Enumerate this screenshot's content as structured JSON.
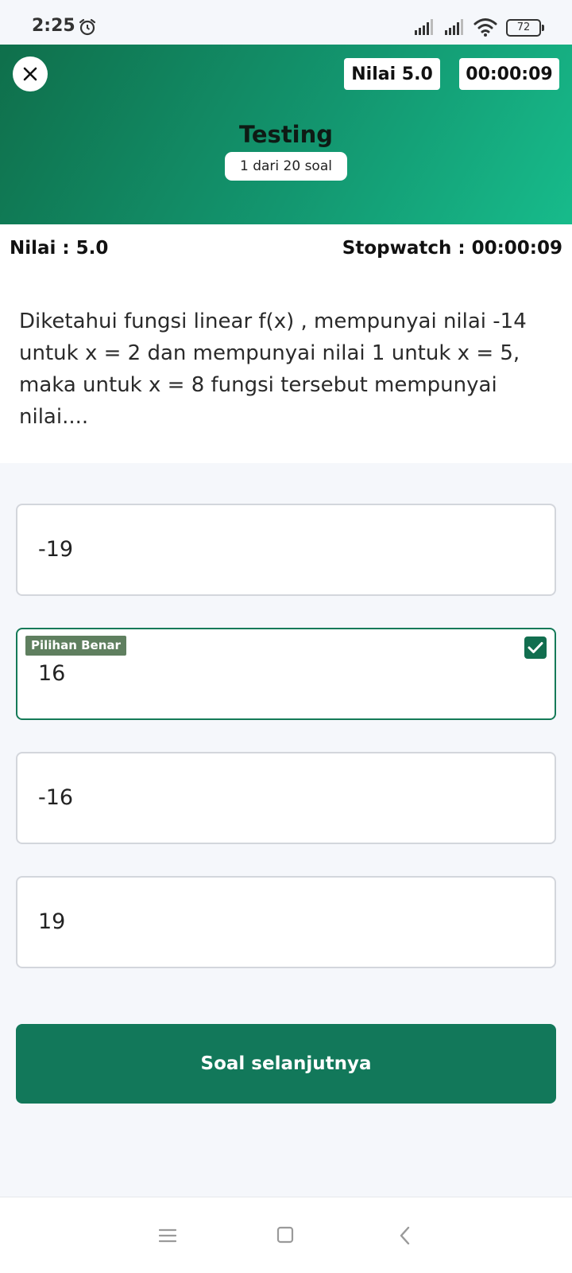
{
  "status_bar": {
    "time": "2:25",
    "battery": "72",
    "icons": [
      "alarm-icon",
      "signal-icon",
      "signal-icon",
      "wifi-icon",
      "battery-icon"
    ]
  },
  "header": {
    "score_chip": "Nilai 5.0",
    "timer_chip": "00:00:09",
    "title": "Testing",
    "progress": "1 dari 20 soal",
    "gradient_start": "#0f6f4b",
    "gradient_end": "#17bb8b"
  },
  "info": {
    "score_label": "Nilai : 5.0",
    "stopwatch_label": "Stopwatch : 00:00:09"
  },
  "question": {
    "text": "Diketahui fungsi linear f(x) , mempunyai nilai -14 untuk x = 2 dan mempunyai nilai 1 untuk x = 5, maka untuk x = 8 fungsi tersebut mempunyai nilai...."
  },
  "options": [
    {
      "label": "-19",
      "correct": false
    },
    {
      "label": "16",
      "correct": true,
      "badge": "Pilihan Benar"
    },
    {
      "label": "-16",
      "correct": false
    },
    {
      "label": "19",
      "correct": false
    }
  ],
  "next_button": {
    "label": "Soal selanjutnya",
    "color": "#12785a"
  },
  "nav_bar": {
    "icons": [
      "menu-icon",
      "home-icon",
      "back-icon"
    ]
  }
}
